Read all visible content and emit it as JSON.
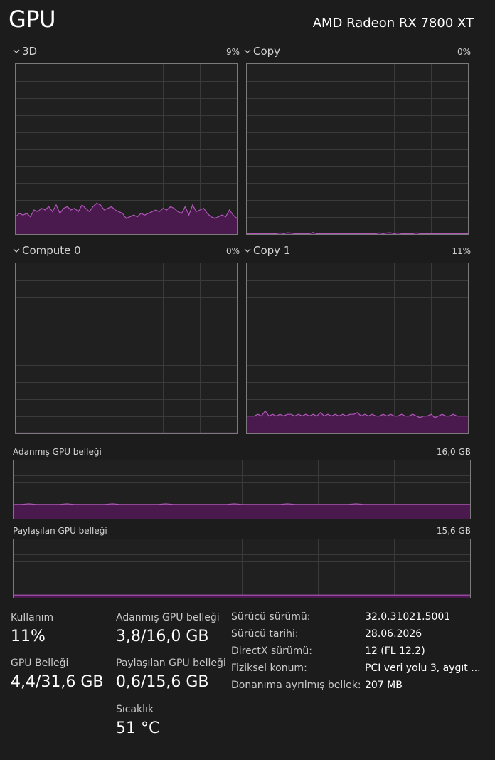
{
  "header": {
    "title": "GPU",
    "gpu_name": "AMD Radeon RX 7800 XT"
  },
  "engines": [
    {
      "label": "3D",
      "percent": "9%",
      "level": 0.09,
      "samples": [
        0.1,
        0.12,
        0.11,
        0.12,
        0.1,
        0.14,
        0.13,
        0.15,
        0.14,
        0.16,
        0.13,
        0.17,
        0.12,
        0.15,
        0.16,
        0.14,
        0.15,
        0.13,
        0.17,
        0.15,
        0.13,
        0.16,
        0.18,
        0.17,
        0.14,
        0.15,
        0.16,
        0.14,
        0.13,
        0.12,
        0.09,
        0.1,
        0.11,
        0.1,
        0.12,
        0.11,
        0.12,
        0.13,
        0.14,
        0.13,
        0.15,
        0.14,
        0.16,
        0.15,
        0.13,
        0.12,
        0.16,
        0.11,
        0.17,
        0.13,
        0.14,
        0.15,
        0.12,
        0.1,
        0.09,
        0.1,
        0.11,
        0.1,
        0.14,
        0.11,
        0.09
      ]
    },
    {
      "label": "Copy",
      "percent": "0%",
      "level": 0.0,
      "samples": [
        0,
        0,
        0,
        0,
        0,
        0,
        0,
        0,
        0,
        0.005,
        0,
        0.006,
        0.004,
        0,
        0,
        0,
        0,
        0,
        0.007,
        0,
        0,
        0,
        0,
        0,
        0,
        0,
        0,
        0,
        0,
        0,
        0,
        0,
        0,
        0,
        0,
        0,
        0.005,
        0,
        0.005,
        0.006,
        0,
        0.005,
        0,
        0,
        0,
        0,
        0.005,
        0,
        0,
        0,
        0,
        0,
        0,
        0,
        0,
        0,
        0,
        0,
        0,
        0,
        0
      ]
    },
    {
      "label": "Compute 0",
      "percent": "0%",
      "level": 0.0,
      "samples": [
        0,
        0,
        0,
        0,
        0,
        0,
        0,
        0,
        0,
        0,
        0,
        0,
        0,
        0,
        0,
        0,
        0,
        0,
        0,
        0,
        0,
        0,
        0,
        0,
        0,
        0,
        0,
        0,
        0,
        0,
        0,
        0,
        0,
        0,
        0,
        0,
        0,
        0,
        0,
        0,
        0,
        0,
        0,
        0,
        0,
        0,
        0,
        0,
        0,
        0,
        0,
        0,
        0,
        0,
        0,
        0,
        0,
        0,
        0,
        0,
        0
      ]
    },
    {
      "label": "Copy 1",
      "percent": "11%",
      "level": 0.11,
      "samples": [
        0.1,
        0.1,
        0.1,
        0.11,
        0.1,
        0.13,
        0.1,
        0.11,
        0.1,
        0.11,
        0.1,
        0.11,
        0.11,
        0.1,
        0.11,
        0.1,
        0.11,
        0.1,
        0.11,
        0.1,
        0.12,
        0.1,
        0.11,
        0.1,
        0.11,
        0.1,
        0.11,
        0.1,
        0.11,
        0.11,
        0.12,
        0.1,
        0.11,
        0.1,
        0.11,
        0.1,
        0.1,
        0.11,
        0.1,
        0.11,
        0.1,
        0.1,
        0.11,
        0.1,
        0.1,
        0.11,
        0.1,
        0.09,
        0.1,
        0.1,
        0.11,
        0.09,
        0.1,
        0.11,
        0.1,
        0.1,
        0.11,
        0.1,
        0.1,
        0.1,
        0.1
      ]
    }
  ],
  "memory": [
    {
      "label": "Adanmış GPU belleği",
      "max": "16,0 GB",
      "level": 0.24,
      "samples": [
        0.24,
        0.24,
        0.25,
        0.24,
        0.24,
        0.24,
        0.24,
        0.25,
        0.24,
        0.24,
        0.24,
        0.24,
        0.24,
        0.25,
        0.24,
        0.24,
        0.24,
        0.24,
        0.24,
        0.24,
        0.25,
        0.24,
        0.24,
        0.24,
        0.24,
        0.24,
        0.24,
        0.24,
        0.24,
        0.25,
        0.24,
        0.24,
        0.24,
        0.24,
        0.24,
        0.24,
        0.25,
        0.24,
        0.24,
        0.24,
        0.24,
        0.24,
        0.24,
        0.24,
        0.24,
        0.25,
        0.24,
        0.24,
        0.24,
        0.24,
        0.24,
        0.24,
        0.24,
        0.24,
        0.24,
        0.24,
        0.24,
        0.24,
        0.24,
        0.24,
        0.24
      ]
    },
    {
      "label": "Paylaşılan GPU belleği",
      "max": "15,6 GB",
      "level": 0.04,
      "samples": [
        0.04,
        0.04,
        0.04,
        0.04,
        0.04,
        0.04,
        0.04,
        0.04,
        0.04,
        0.04,
        0.04,
        0.04,
        0.04,
        0.04,
        0.04,
        0.04,
        0.04,
        0.04,
        0.04,
        0.04,
        0.04,
        0.04,
        0.04,
        0.04,
        0.04,
        0.04,
        0.04,
        0.04,
        0.04,
        0.04,
        0.04,
        0.04,
        0.04,
        0.04,
        0.04,
        0.04,
        0.04,
        0.04,
        0.04,
        0.04,
        0.04,
        0.04,
        0.04,
        0.04,
        0.04,
        0.04,
        0.04,
        0.04,
        0.04,
        0.04,
        0.04,
        0.04,
        0.04,
        0.04,
        0.04,
        0.04,
        0.04,
        0.04,
        0.04,
        0.04,
        0.04
      ]
    }
  ],
  "stats": {
    "utilization": {
      "label": "Kullanım",
      "value": "11%"
    },
    "gpu_memory": {
      "label": "GPU Belleği",
      "value": "4,4/31,6 GB"
    },
    "dedicated": {
      "label": "Adanmış GPU belleği",
      "value": "3,8/16,0 GB"
    },
    "shared": {
      "label": "Paylaşılan GPU belleği",
      "value": "0,6/15,6 GB"
    },
    "temperature": {
      "label": "Sıcaklık",
      "value": "51 °C"
    }
  },
  "properties": [
    {
      "label": "Sürücü sürümü:",
      "value": "32.0.31021.5001"
    },
    {
      "label": "Sürücü tarihi:",
      "value": "28.06.2026"
    },
    {
      "label": "DirectX sürümü:",
      "value": "12 (FL 12.2)"
    },
    {
      "label": "Fiziksel konum:",
      "value": "PCI veri yolu 3, aygıt ..."
    },
    {
      "label": "Donanıma ayrılmış bellek:",
      "value": "207 MB"
    }
  ],
  "colors": {
    "accent_line": "#b057b8",
    "accent_fill": "#4a1a4f",
    "grid": "#3a3a3a",
    "border": "#7a7a7a"
  }
}
